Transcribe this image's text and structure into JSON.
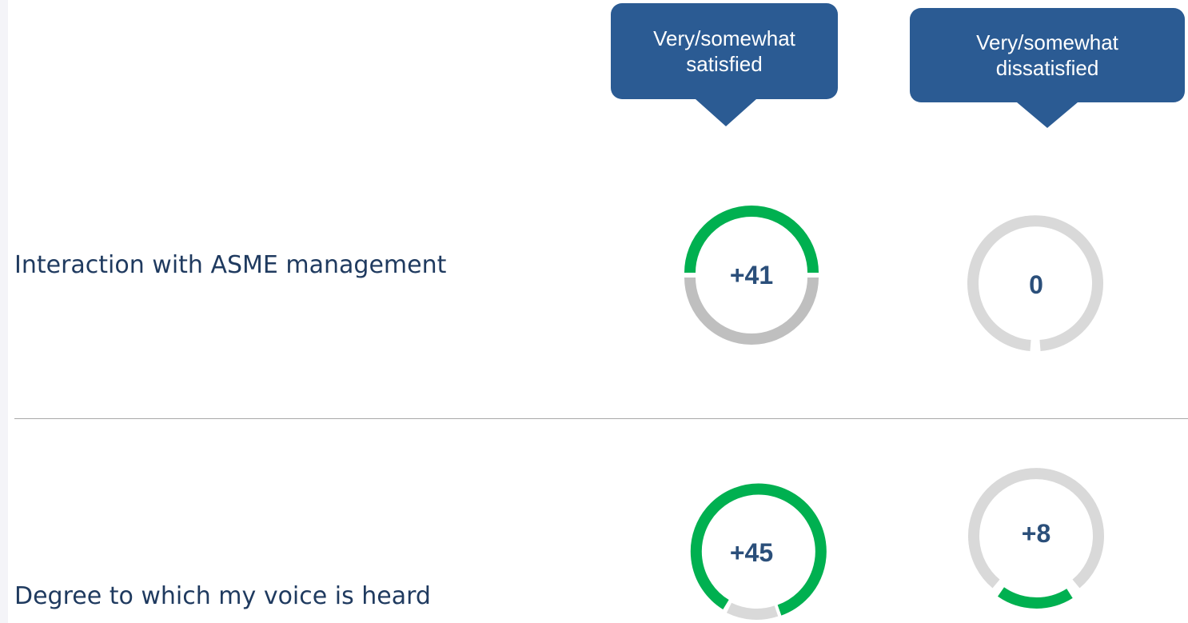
{
  "chart_data": {
    "type": "donut-grid",
    "columns": [
      {
        "label_line1": "Very/somewhat",
        "label_line2": "satisfied"
      },
      {
        "label_line1": "Very/somewhat",
        "label_line2": "dissatisfied"
      }
    ],
    "rows": [
      {
        "label": "Interaction with ASME management",
        "values": [
          "+41",
          "0"
        ]
      },
      {
        "label": "Degree to which my voice is heard",
        "values": [
          "+45",
          "+8"
        ]
      }
    ],
    "colors": {
      "header_bg": "#2b5b93",
      "positive": "#00b050",
      "neutral_dark": "#bfbfbf",
      "neutral_light": "#d9d9d9",
      "value_text": "#2b4f7a",
      "label_text": "#1f3a5f"
    }
  }
}
